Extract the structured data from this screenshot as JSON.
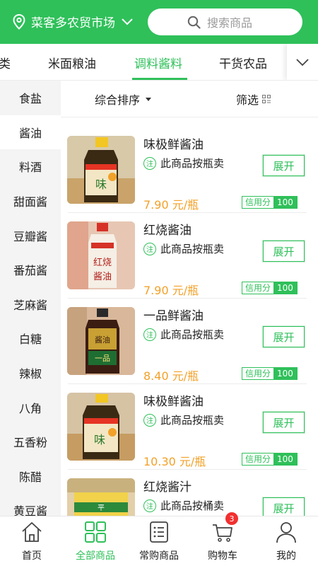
{
  "header": {
    "location": "菜客多农贸市场",
    "search_placeholder": "搜索商品"
  },
  "tabs": [
    {
      "label": "类"
    },
    {
      "label": "米面粮油"
    },
    {
      "label": "调料酱料"
    },
    {
      "label": "干货农品"
    }
  ],
  "active_tab": "调料酱料",
  "sidebar": {
    "items": [
      {
        "label": "食盐"
      },
      {
        "label": "酱油"
      },
      {
        "label": "料酒"
      },
      {
        "label": "甜面酱"
      },
      {
        "label": "豆瓣酱"
      },
      {
        "label": "番茄酱"
      },
      {
        "label": "芝麻酱"
      },
      {
        "label": "白糖"
      },
      {
        "label": "辣椒"
      },
      {
        "label": "八角"
      },
      {
        "label": "五香粉"
      },
      {
        "label": "陈醋"
      },
      {
        "label": "黄豆酱"
      }
    ],
    "active": "酱油"
  },
  "sortbar": {
    "sort_label": "综合排序",
    "filter_label": "筛选"
  },
  "products": [
    {
      "name": "味极鲜酱油",
      "badge": "注",
      "note": "此商品按瓶卖",
      "button": "展开",
      "price": "7.90 元/瓶",
      "credit_label": "信用分",
      "credit_value": "100"
    },
    {
      "name": "红烧酱油",
      "badge": "注",
      "note": "此商品按瓶卖",
      "button": "展开",
      "price": "7.90 元/瓶",
      "credit_label": "信用分",
      "credit_value": "100"
    },
    {
      "name": "一品鲜酱油",
      "badge": "注",
      "note": "此商品按瓶卖",
      "button": "展开",
      "price": "8.40 元/瓶",
      "credit_label": "信用分",
      "credit_value": "100"
    },
    {
      "name": "味极鲜酱油",
      "badge": "注",
      "note": "此商品按瓶卖",
      "button": "展开",
      "price": "10.30 元/瓶",
      "credit_label": "信用分",
      "credit_value": "100"
    },
    {
      "name": "红烧酱汁",
      "badge": "注",
      "note": "此商品按桶卖",
      "button": "展开",
      "price": "",
      "credit_label": "",
      "credit_value": ""
    }
  ],
  "bottom_nav": [
    {
      "label": "首页",
      "icon": "home-icon"
    },
    {
      "label": "全部商品",
      "icon": "grid-icon"
    },
    {
      "label": "常购商品",
      "icon": "list-icon"
    },
    {
      "label": "购物车",
      "icon": "cart-icon",
      "badge": "3"
    },
    {
      "label": "我的",
      "icon": "person-icon"
    }
  ],
  "active_nav": "全部商品",
  "colors": {
    "brand_green": "#2fc05a",
    "price_orange": "#f2a129",
    "badge_red": "#f23030"
  }
}
